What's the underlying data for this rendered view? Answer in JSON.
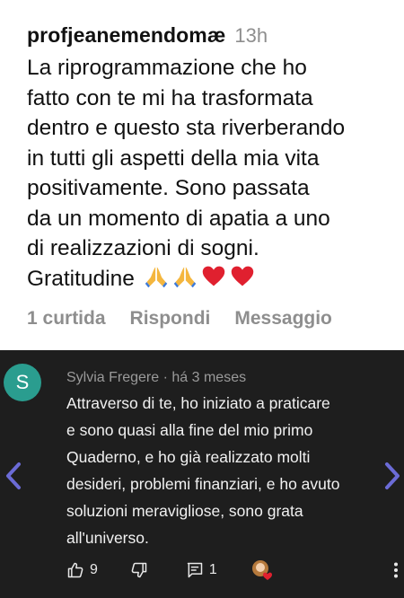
{
  "instagram_comment": {
    "username": "profjeanemendomæ",
    "time": "13h",
    "text_lines": [
      "La riprogrammazione che ho",
      "fatto con te mi ha trasformata",
      "dentro e questo sta riverberando",
      "in tutti gli aspetti della mia vita",
      "positivamente. Sono passata",
      "da un momento di apatia a uno",
      "di realizzazioni di sogni.",
      "Gratitudine"
    ],
    "emojis": [
      "folded-hands",
      "folded-hands",
      "red-heart",
      "red-heart"
    ],
    "actions": {
      "likes": "1 curtida",
      "reply": "Rispondi",
      "message": "Messaggio"
    }
  },
  "youtube_comment": {
    "avatar_letter": "S",
    "avatar_color": "#2a9d8f",
    "author": "Sylvia Fregere",
    "time": "há 3 meses",
    "meta_separator": "·",
    "text_lines": [
      "Attraverso di te, ho iniziato a praticare",
      "e sono quasi alla fine del mio primo",
      "Quaderno, e ho già realizzato molti",
      "desideri, problemi finanziari, e ho avuto",
      "soluzioni meravigliose, sono grata",
      "all'universo."
    ],
    "like_count": "9",
    "reply_count": "1",
    "icons": [
      "thumbs-up",
      "thumbs-down",
      "comment",
      "creator-heart",
      "more-vertical",
      "chevron-left",
      "chevron-right"
    ],
    "colors": {
      "background": "#1e1e1e",
      "nav_arrow": "#6b6bd6"
    }
  }
}
